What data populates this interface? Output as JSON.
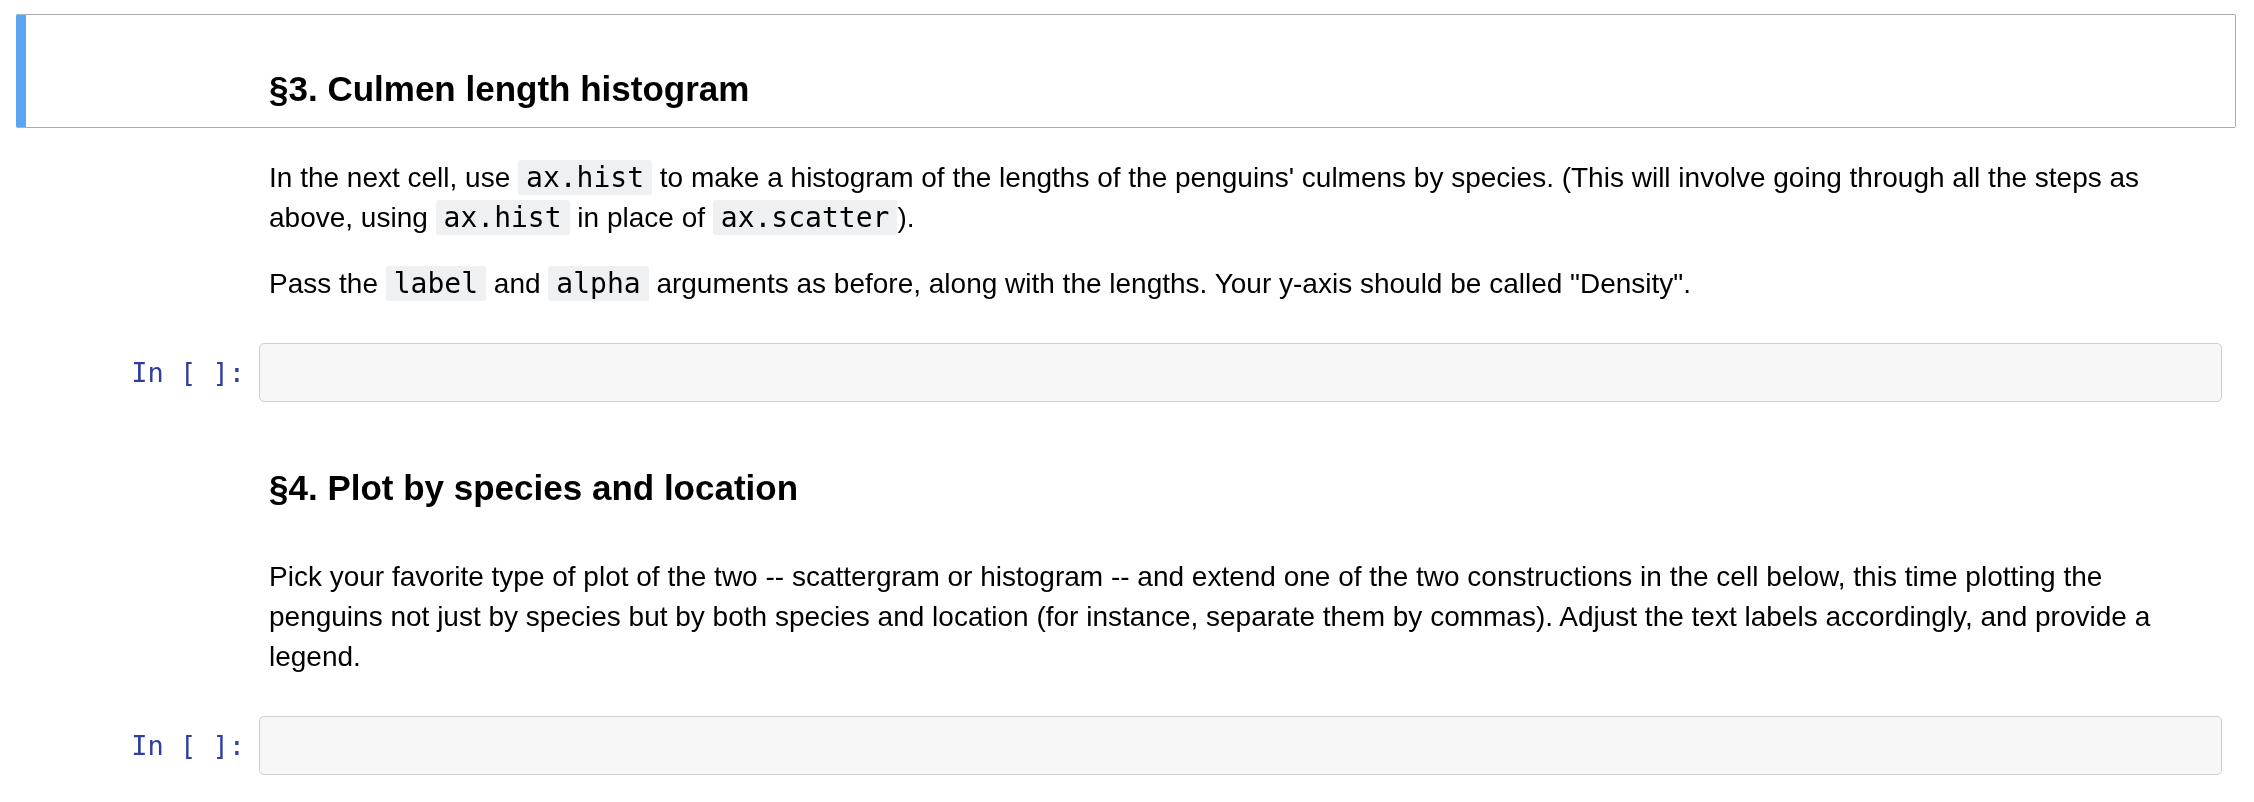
{
  "cells": [
    {
      "kind": "markdown",
      "selected": true,
      "blocks": [
        {
          "kind": "heading",
          "text": "§3. Culmen length histogram"
        }
      ]
    },
    {
      "kind": "markdown",
      "selected": false,
      "blocks": [
        {
          "kind": "paragraph",
          "parts": [
            {
              "kind": "text",
              "text": "In the next cell, use "
            },
            {
              "kind": "code",
              "text": "ax.hist"
            },
            {
              "kind": "text",
              "text": " to make a histogram of the lengths of the penguins' culmens by species. (This will involve going through all the steps as above, using "
            },
            {
              "kind": "code",
              "text": "ax.hist"
            },
            {
              "kind": "text",
              "text": " in place of "
            },
            {
              "kind": "code",
              "text": "ax.scatter"
            },
            {
              "kind": "text",
              "text": ")."
            }
          ]
        },
        {
          "kind": "paragraph",
          "parts": [
            {
              "kind": "text",
              "text": "Pass the "
            },
            {
              "kind": "code",
              "text": "label"
            },
            {
              "kind": "text",
              "text": " and "
            },
            {
              "kind": "code",
              "text": "alpha"
            },
            {
              "kind": "text",
              "text": " arguments as before, along with the lengths. Your y-axis should be called \"Density\"."
            }
          ]
        }
      ]
    },
    {
      "kind": "code",
      "selected": false,
      "prompt": "In [ ]:"
    },
    {
      "kind": "markdown",
      "selected": false,
      "blocks": [
        {
          "kind": "heading",
          "text": "§4. Plot by species and location"
        }
      ]
    },
    {
      "kind": "markdown",
      "selected": false,
      "blocks": [
        {
          "kind": "paragraph",
          "parts": [
            {
              "kind": "text",
              "text": "Pick your favorite type of plot of the two -- scattergram or histogram -- and extend one of the two constructions in the cell below, this time plotting the penguins not just by species but by both species and location (for instance, separate them by commas). Adjust the text labels accordingly, and provide a legend."
            }
          ]
        }
      ]
    },
    {
      "kind": "code",
      "selected": false,
      "prompt": "In [ ]:"
    }
  ]
}
